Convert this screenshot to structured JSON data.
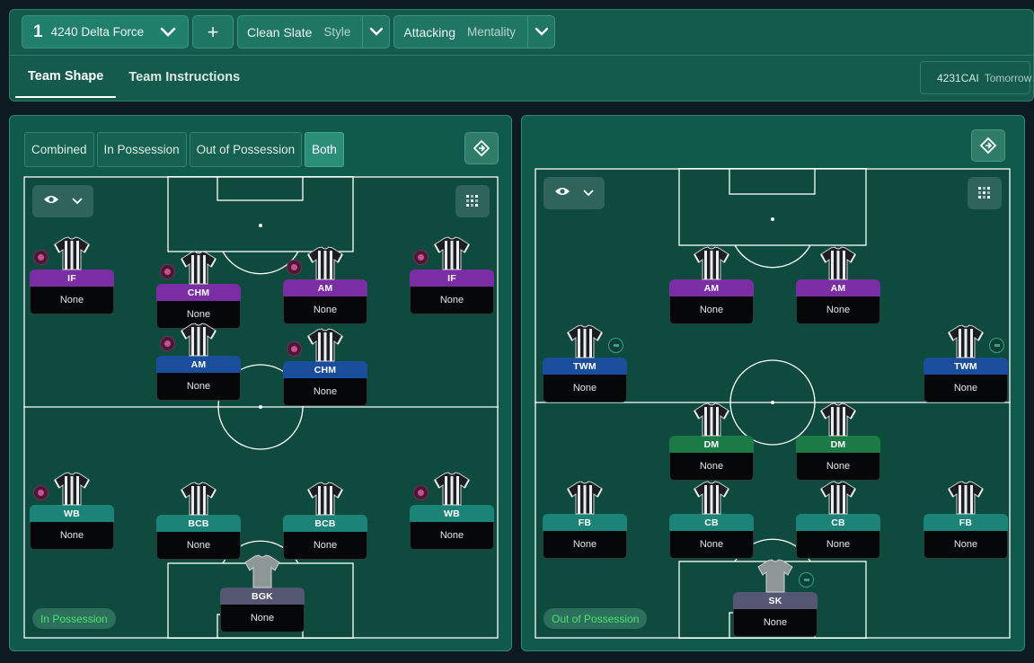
{
  "header": {
    "tactic_number": "1",
    "tactic_name": "4240  Delta Force",
    "add_label": "+",
    "style_value": "Clean Slate",
    "style_label": "Style",
    "mentality_value": "Attacking",
    "mentality_label": "Mentality",
    "tabs": [
      "Team Shape",
      "Team Instructions"
    ],
    "opponent": {
      "code": "4231CAI",
      "when": "Tomorrow"
    }
  },
  "left_panel": {
    "segments": [
      "Combined",
      "In Possession",
      "Out of Possession",
      "Both"
    ],
    "active_segment": "Both",
    "phase_label": "In Possession",
    "players": [
      {
        "pos": "IF",
        "name": "None",
        "color": "purple"
      },
      {
        "pos": "CHM",
        "name": "None",
        "color": "purple"
      },
      {
        "pos": "AM",
        "name": "None",
        "color": "purple"
      },
      {
        "pos": "IF",
        "name": "None",
        "color": "purple"
      },
      {
        "pos": "AM",
        "name": "None",
        "color": "blue"
      },
      {
        "pos": "CHM",
        "name": "None",
        "color": "blue"
      },
      {
        "pos": "WB",
        "name": "None",
        "color": "teal"
      },
      {
        "pos": "BCB",
        "name": "None",
        "color": "teal"
      },
      {
        "pos": "BCB",
        "name": "None",
        "color": "teal"
      },
      {
        "pos": "WB",
        "name": "None",
        "color": "teal"
      },
      {
        "pos": "BGK",
        "name": "None",
        "color": "slate"
      }
    ]
  },
  "right_panel": {
    "phase_label": "Out of Possession",
    "players": [
      {
        "pos": "AM",
        "name": "None",
        "color": "purple"
      },
      {
        "pos": "AM",
        "name": "None",
        "color": "purple"
      },
      {
        "pos": "TWM",
        "name": "None",
        "color": "blue"
      },
      {
        "pos": "TWM",
        "name": "None",
        "color": "blue"
      },
      {
        "pos": "DM",
        "name": "None",
        "color": "green"
      },
      {
        "pos": "DM",
        "name": "None",
        "color": "green"
      },
      {
        "pos": "FB",
        "name": "None",
        "color": "teal"
      },
      {
        "pos": "CB",
        "name": "None",
        "color": "teal"
      },
      {
        "pos": "CB",
        "name": "None",
        "color": "teal"
      },
      {
        "pos": "FB",
        "name": "None",
        "color": "teal"
      },
      {
        "pos": "SK",
        "name": "None",
        "color": "slate"
      }
    ]
  },
  "icons": {
    "tactic_dropdown": "chevron-down-icon",
    "swap": "swap-sides-icon",
    "visibility": "eye-icon",
    "grid": "grid-dots-icon",
    "shirt": "shirt-icon",
    "role_attack": "attack-role-icon",
    "role_defend": "defend-role-icon"
  },
  "colors": {
    "purple": "#7b2ea4",
    "blue": "#1a4e9c",
    "teal": "#1b8377",
    "green": "#1b7a45",
    "slate": "#545672",
    "pitch": "#0e4a3d",
    "phase_text": "#4ee36f"
  }
}
